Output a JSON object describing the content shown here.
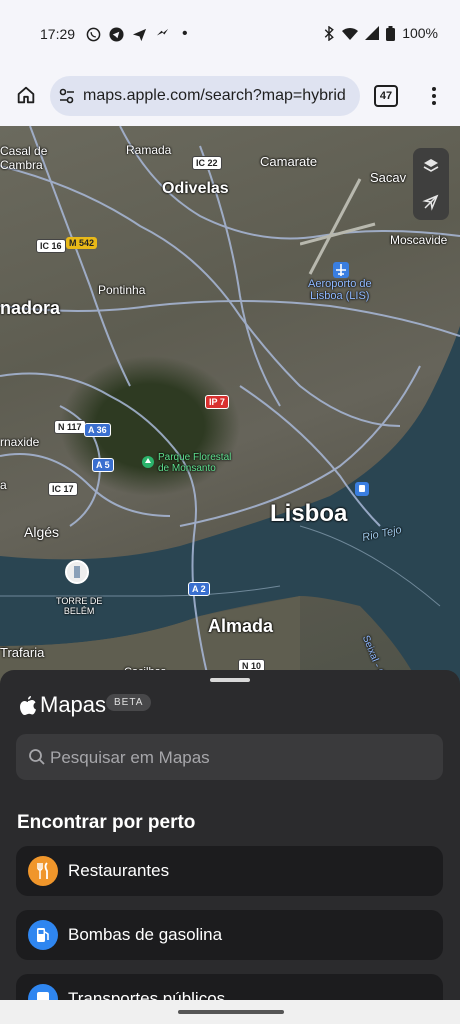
{
  "status_bar": {
    "time": "17:29",
    "battery": "100%"
  },
  "browser": {
    "url": "maps.apple.com/search?map=hybrid",
    "tab_count": "47"
  },
  "map": {
    "labels": {
      "casal_de_cambra": "Casal de Cambra",
      "ramada": "Ramada",
      "camarate": "Camarate",
      "sacavem": "Sacav",
      "odivelas": "Odivelas",
      "moscavide": "Moscavide",
      "pontinha": "Pontinha",
      "amadora": "nadora",
      "aeroporto": "Aeroporto de\nLisboa (LIS)",
      "parque": "Parque Florestal\nde Monsanto",
      "carnaxide": "rnaxide",
      "lisboa": "Lisboa",
      "alges": "Algés",
      "torre": "TORRE DE\nBELÉM",
      "rio_tejo": "Rio Tejo",
      "seixal": "Seixal - Cais do",
      "almada": "Almada",
      "trafaria": "Trafaria",
      "cacilhas": "Cacilhas",
      "ba": "a"
    },
    "shields": {
      "ic22": "IC 22",
      "ic16": "IC 16",
      "m542": "M 542",
      "n117": "N 117",
      "a36": "A 36",
      "ip7": "IP 7",
      "a5": "A 5",
      "ic17": "IC 17",
      "a2": "A 2",
      "n10": "N 10"
    }
  },
  "sheet": {
    "brand": "Mapas",
    "beta_badge": "BETA",
    "search_placeholder": "Pesquisar em Mapas",
    "section_title": "Encontrar por perto",
    "categories": [
      {
        "label": "Restaurantes",
        "color": "#f0962b",
        "icon": "fork-knife-icon"
      },
      {
        "label": "Bombas de gasolina",
        "color": "#2f86f0",
        "icon": "fuel-icon"
      },
      {
        "label": "Transportes públicos",
        "color": "#2f86f0",
        "icon": "bus-icon"
      }
    ]
  }
}
